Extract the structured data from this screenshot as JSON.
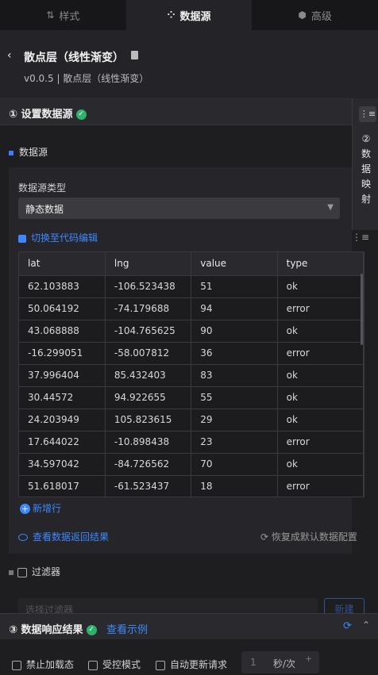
{
  "tabs": [
    {
      "icon": "⇅",
      "label": "样式"
    },
    {
      "icon": "⁘",
      "label": "数据源"
    },
    {
      "icon": "⬢",
      "label": "高级"
    }
  ],
  "header": {
    "back": "‹",
    "title": "散点层（线性渐变）",
    "subtitle": "v0.0.5 | 散点层（线性渐变）"
  },
  "section1": {
    "label": "① 设置数据源",
    "status": "✓"
  },
  "side": {
    "icon": "⋮≡",
    "label": "② 数据映射"
  },
  "datasource": {
    "heading": "数据源",
    "type_label": "数据源类型",
    "type_value": "静态数据",
    "code_edit": "切换至代码编辑",
    "table": {
      "headers": [
        "lat",
        "lng",
        "value",
        "type"
      ],
      "rows": [
        [
          "62.103883",
          "-106.523438",
          "51",
          "ok"
        ],
        [
          "50.064192",
          "-74.179688",
          "94",
          "error"
        ],
        [
          "43.068888",
          "-104.765625",
          "90",
          "ok"
        ],
        [
          "-16.299051",
          "-58.007812",
          "36",
          "error"
        ],
        [
          "37.996404",
          "85.432403",
          "83",
          "ok"
        ],
        [
          "30.44572",
          "94.922655",
          "55",
          "ok"
        ],
        [
          "24.203949",
          "105.823615",
          "29",
          "ok"
        ],
        [
          "17.644022",
          "-10.898438",
          "23",
          "error"
        ],
        [
          "34.597042",
          "-84.726562",
          "70",
          "ok"
        ],
        [
          "51.618017",
          "-61.523437",
          "18",
          "error"
        ]
      ]
    },
    "add_row": "新增行",
    "view_result": "查看数据返回结果",
    "restore": "⟳ 恢复成默认数据配置"
  },
  "filter": {
    "label": "过滤器",
    "placeholder": "选择过滤器",
    "new": "新建"
  },
  "section3": {
    "label": "③ 数据响应结果",
    "status": "✓",
    "example": "查看示例"
  },
  "options": {
    "disable_loading": "禁止加载态",
    "controlled": "受控模式",
    "auto_update": "自动更新请求",
    "interval_value": "1",
    "interval_unit": "秒/次"
  },
  "colors": {
    "accent": "#3d88ff",
    "success": "#2fb36b",
    "bg": "#1e1e21"
  }
}
